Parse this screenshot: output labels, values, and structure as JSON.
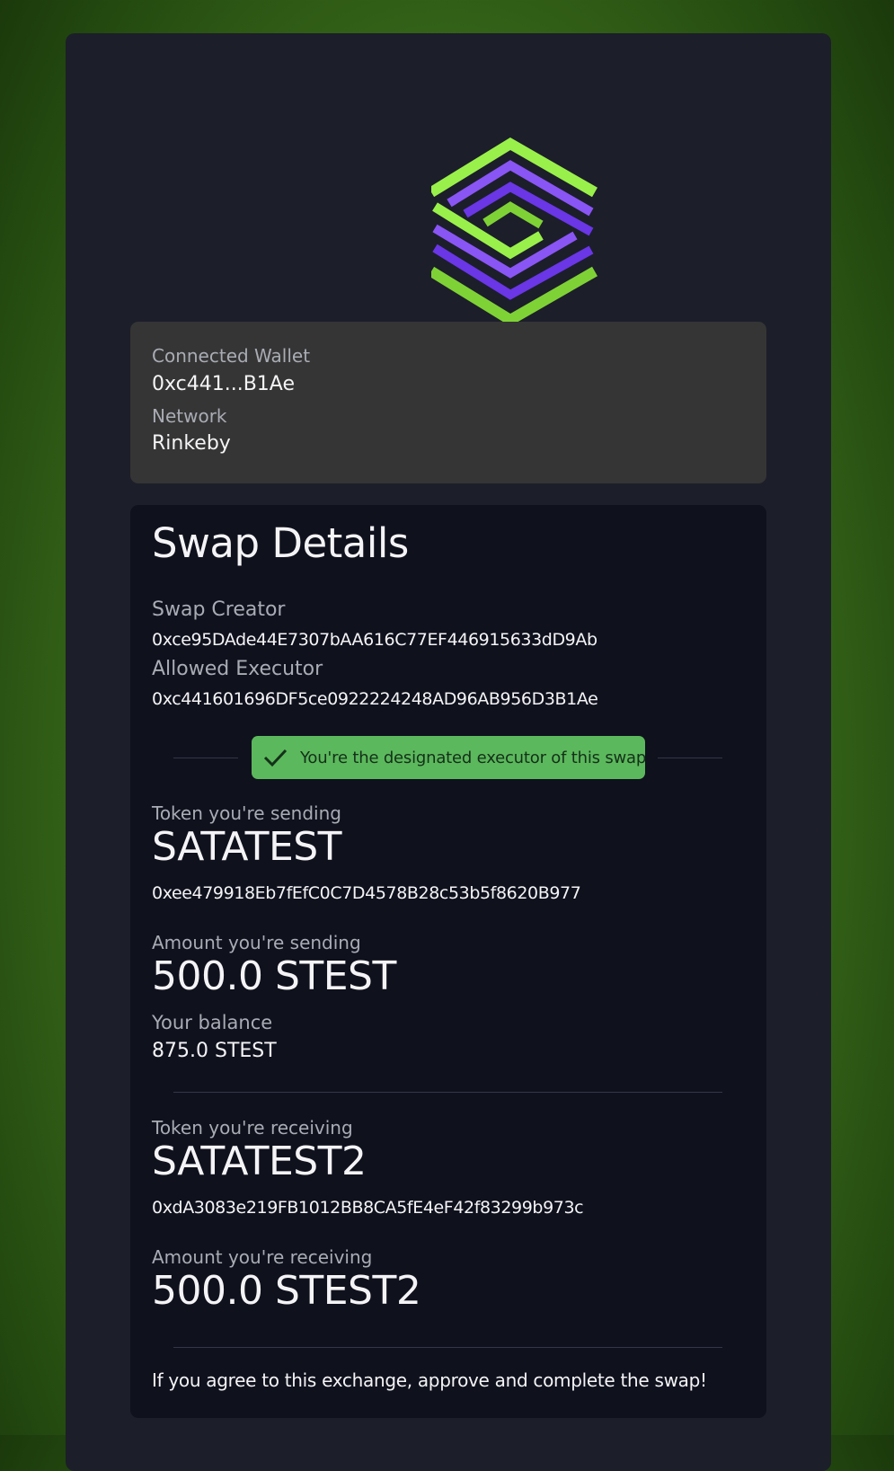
{
  "wallet": {
    "connected_label": "Connected Wallet",
    "connected_value": "0xc441...B1Ae",
    "network_label": "Network",
    "network_value": "Rinkeby"
  },
  "swap": {
    "title": "Swap Details",
    "creator_label": "Swap Creator",
    "creator_value": "0xce95DAde44E7307bAA616C77EF446915633dD9Ab",
    "executor_label": "Allowed Executor",
    "executor_value": "0xc441601696DF5ce0922224248AD96AB956D3B1Ae",
    "executor_badge": "You're the designated executor of this swap",
    "sending_token_label": "Token you're sending",
    "sending_token_name": "SATATEST",
    "sending_token_address": "0xee479918Eb7fEfC0C7D4578B28c53b5f8620B977",
    "sending_amount_label": "Amount you're sending",
    "sending_amount_value": "500.0 STEST",
    "balance_label": "Your balance",
    "balance_value": "875.0 STEST",
    "receiving_token_label": "Token you're receiving",
    "receiving_token_name": "SATATEST2",
    "receiving_token_address": "0xdA3083e219FB1012BB8CA5fE4eF42f83299b973c",
    "receiving_amount_label": "Amount you're receiving",
    "receiving_amount_value": "500.0 STEST2",
    "footer_text": "If you agree to this exchange, approve and complete the swap!"
  },
  "colors": {
    "accent_green": "#9af04b",
    "accent_purple": "#7b45f2",
    "badge_green": "#5cb85c",
    "card_bg": "#1c1e2a",
    "panel_bg": "#0f111d",
    "wallet_panel_bg": "#353535"
  },
  "icons": {
    "logo": "hexagon-stripes-logo",
    "badge_icon": "check-icon"
  }
}
